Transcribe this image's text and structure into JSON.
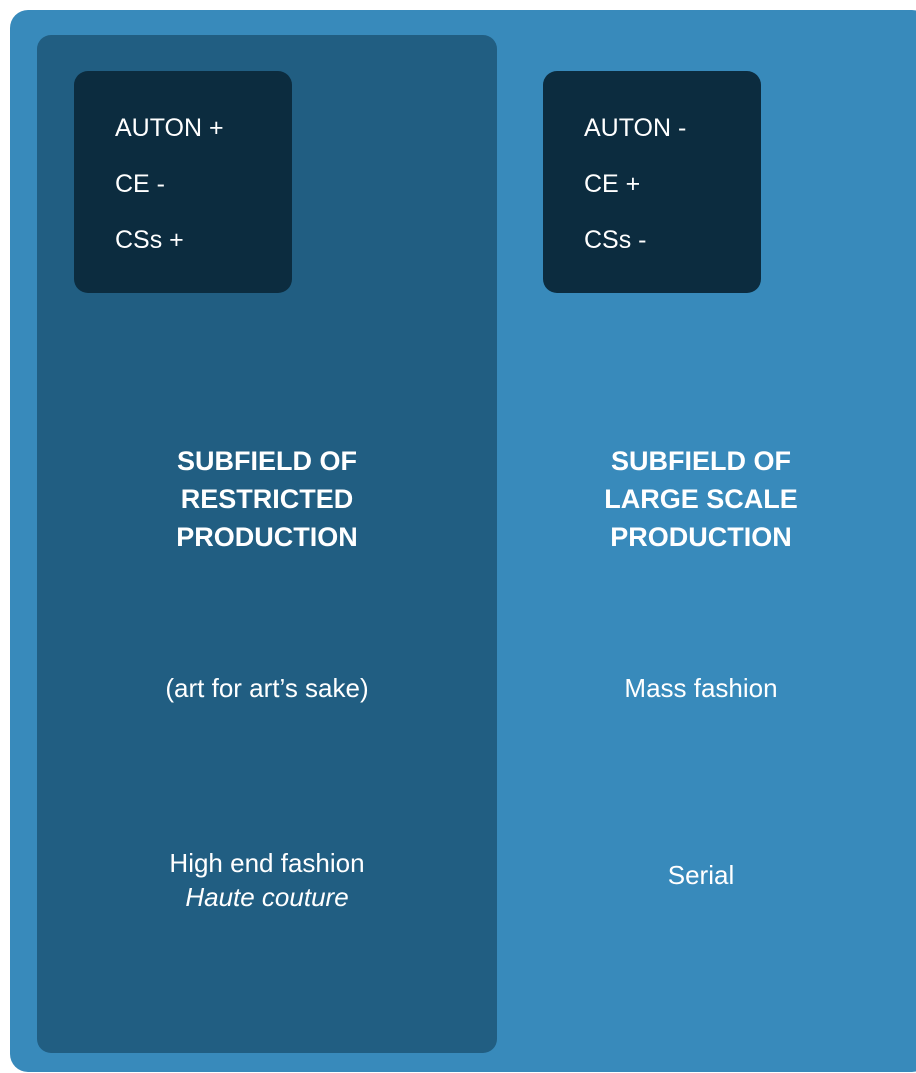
{
  "left": {
    "indicators": [
      "AUTON +",
      "CE -",
      "CSs +"
    ],
    "title_lines": [
      "SUBFIELD OF",
      "RESTRICTED",
      "PRODUCTION"
    ],
    "tagline": "(art for art’s sake)",
    "example": "High end fashion",
    "example_italic": "Haute couture"
  },
  "right": {
    "indicators": [
      "AUTON -",
      "CE +",
      "CSs -"
    ],
    "title_lines": [
      "SUBFIELD OF",
      "LARGE SCALE",
      "PRODUCTION"
    ],
    "tagline": "Mass fashion",
    "example": "Serial"
  },
  "colors": {
    "background": "#388ABB",
    "left_column": "#215E82",
    "indicator_box": "#0C2C3F",
    "text": "#FFFFFF"
  }
}
